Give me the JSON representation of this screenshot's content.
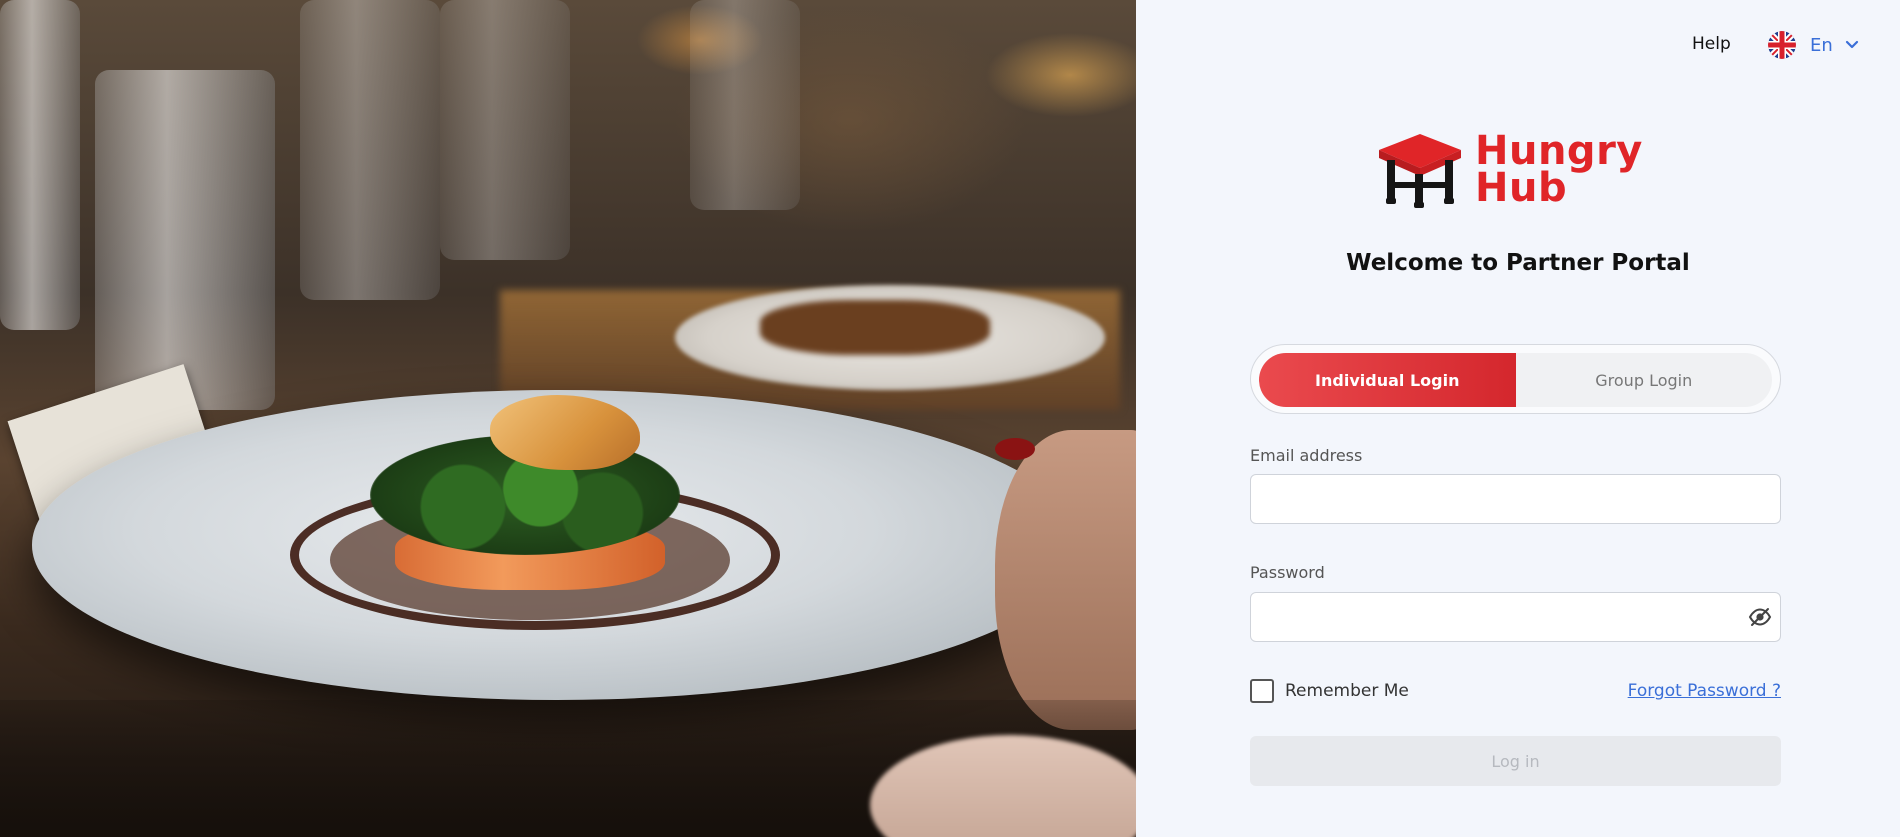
{
  "header": {
    "help_label": "Help",
    "language_code": "En",
    "language_flag_icon": "uk-flag-icon",
    "language_dropdown_icon": "chevron-down-icon"
  },
  "brand": {
    "logo_icon": "hungry-hub-table-icon",
    "name_line1": "Hungry",
    "name_line2": "Hub",
    "color": "#e02528"
  },
  "welcome_title": "Welcome to Partner Portal",
  "login_tabs": {
    "active": "Individual Login",
    "inactive": "Group Login"
  },
  "form": {
    "email_label": "Email address",
    "email_value": "",
    "password_label": "Password",
    "password_value": "",
    "password_toggle_icon": "eye-icon",
    "remember_label": "Remember Me",
    "remember_checked": false,
    "forgot_label": "Forgot Password ?",
    "submit_label": "Log in"
  },
  "colors": {
    "accent": "#e02528",
    "link": "#3a6fd8",
    "panel_bg": "#f3f6fc",
    "disabled_button": "#e7e9ed"
  }
}
